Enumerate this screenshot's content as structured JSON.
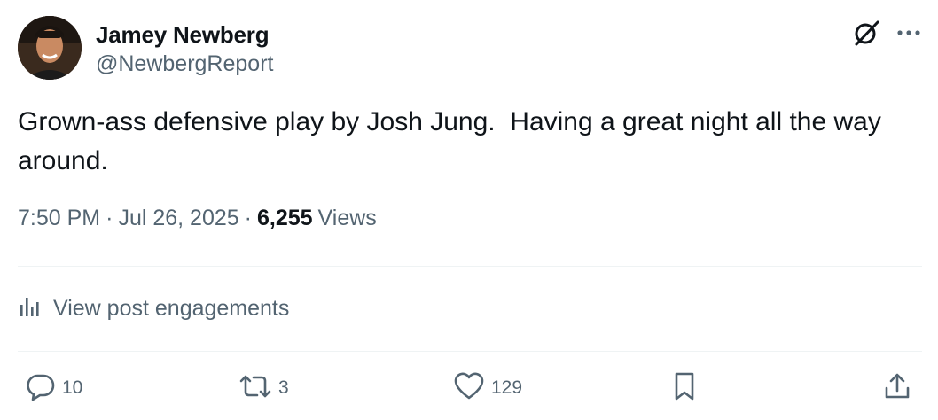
{
  "author": {
    "name": "Jamey Newberg",
    "handle": "@NewbergReport"
  },
  "post": {
    "text": "Grown-ass defensive play by Josh Jung.  Having a great night all the way\naround."
  },
  "meta": {
    "time": "7:50 PM",
    "separator": "·",
    "date": "Jul 26, 2025",
    "views_count": "6,255",
    "views_label": "Views"
  },
  "engagements": {
    "label": "View post engagements",
    "icon": "analytics-bars-icon"
  },
  "actions": {
    "reply": {
      "icon": "reply-bubble-icon",
      "count": "10"
    },
    "repost": {
      "icon": "repost-arrows-icon",
      "count": "3"
    },
    "like": {
      "icon": "heart-icon",
      "count": "129"
    },
    "bookmark": {
      "icon": "bookmark-icon"
    },
    "share": {
      "icon": "share-upload-icon"
    }
  },
  "colors": {
    "primary_text": "#0f1419",
    "secondary_text": "#536471",
    "divider": "#eff3f4"
  }
}
